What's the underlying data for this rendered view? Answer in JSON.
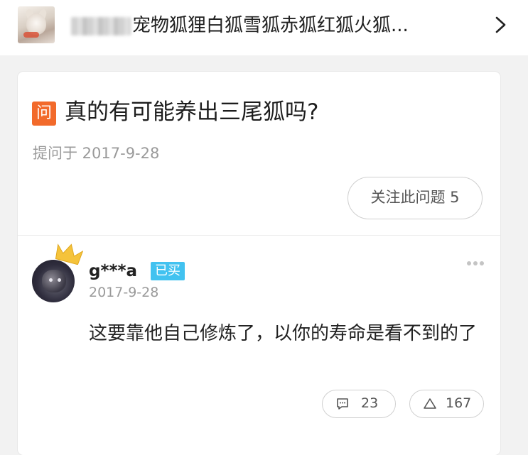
{
  "header": {
    "title": "宠物狐狸白狐雪狐赤狐红狐火狐...",
    "thumbnail_icon": "fox-photo-icon",
    "chevron_icon": "chevron-right-icon"
  },
  "question": {
    "badge": "问",
    "title": "真的有可能养出三尾狐吗?",
    "asked_at": "提问于 2017-9-28",
    "follow_button": "关注此问题 5"
  },
  "answer": {
    "username": "g***a",
    "bought_badge": "已买",
    "date": "2017-9-28",
    "text": "这要靠他自己修炼了，以你的寿命是看不到的了",
    "comment_count": "23",
    "like_count": "167",
    "icons": {
      "avatar": "avatar-photo",
      "crown": "crown-icon",
      "more": "more-dots-icon",
      "comment": "comment-icon",
      "like": "upvote-triangle-icon"
    }
  },
  "colors": {
    "badge_orange": "#f26a2b",
    "bought_blue": "#42c2f0",
    "crown_gold": "#f5c33b",
    "page_bg": "#f2f2f2"
  }
}
